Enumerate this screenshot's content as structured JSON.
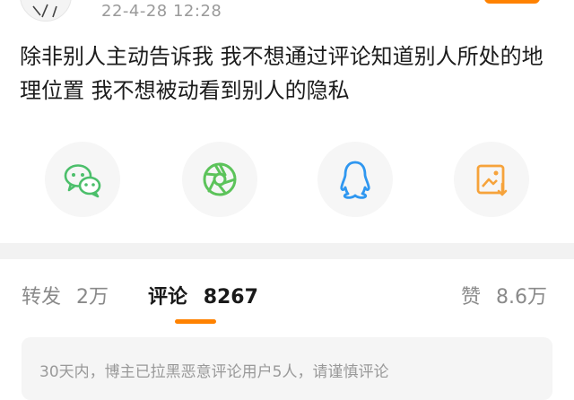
{
  "post": {
    "timestamp": "22-4-28 12:28",
    "text": "除非别人主动告诉我 我不想通过评论知道别人所处的地理位置 我不想被动看到别人的隐私"
  },
  "share": {
    "items": [
      {
        "icon": "wechat-icon",
        "color": "#4cbf6b"
      },
      {
        "icon": "moments-icon",
        "color": "#5cc35a"
      },
      {
        "icon": "qq-icon",
        "color": "#2f97f0"
      },
      {
        "icon": "save-image-icon",
        "color": "#f6a33b"
      }
    ]
  },
  "tabs": {
    "repost_label": "转发",
    "repost_count": "2万",
    "comment_label": "评论",
    "comment_count": "8267",
    "like_label": "赞",
    "like_count": "8.6万"
  },
  "notice": {
    "text": "30天内，博主已拉黑恶意评论用户5人，请谨慎评论"
  },
  "colors": {
    "accent": "#ff8200",
    "muted_text": "#8a8a8a"
  }
}
